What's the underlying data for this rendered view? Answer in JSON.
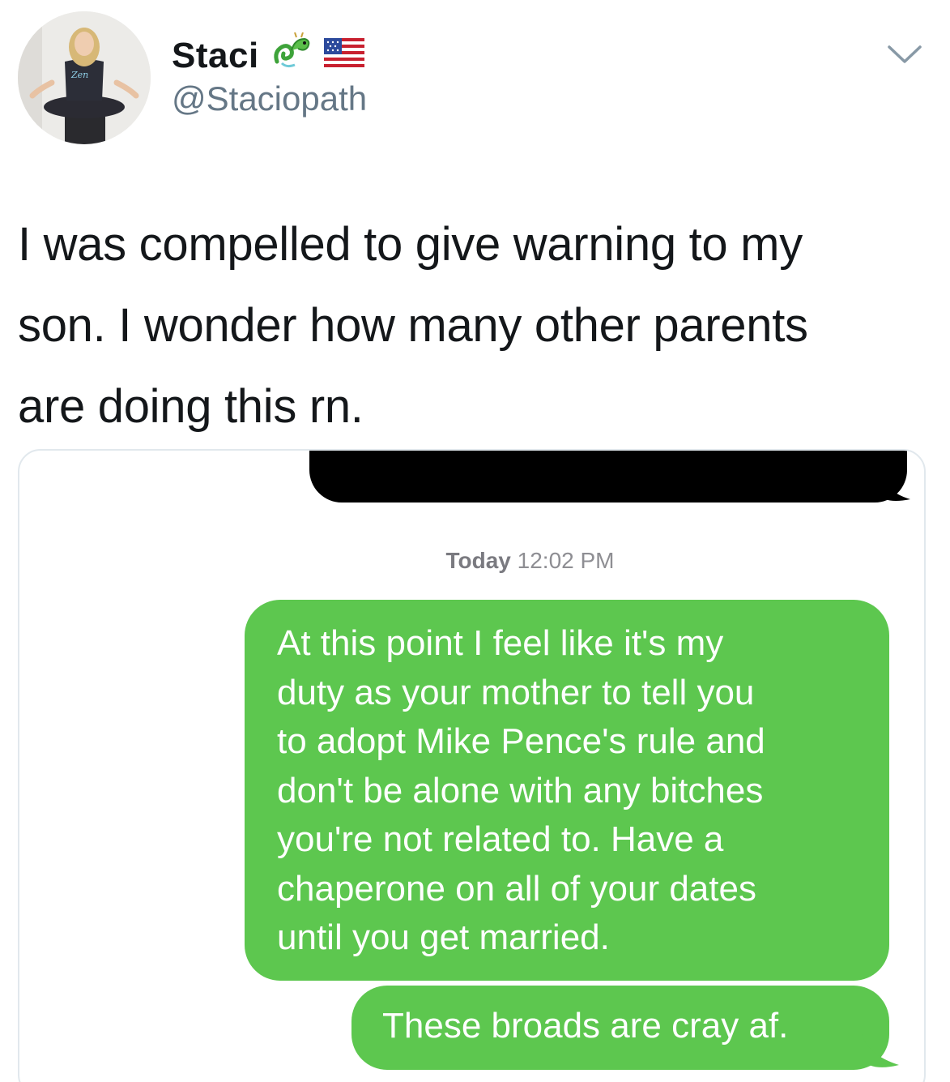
{
  "author": {
    "display_name": "Staci",
    "handle": "@Staciopath",
    "badges": [
      "dragon-emoji",
      "us-flag-emoji"
    ]
  },
  "tweet": {
    "lines": [
      "I was compelled to give warning to my",
      "son. I wonder how many other parents",
      "are doing this rn."
    ]
  },
  "media": {
    "timestamp_day": "Today",
    "timestamp_time": "12:02 PM",
    "messages": [
      {
        "lines": [
          "At this point I feel like it's my",
          "duty as your mother to tell you",
          "to adopt Mike Pence's rule and",
          "don't be alone with any bitches",
          "you're not related to. Have a",
          "chaperone on all of your dates",
          "until you get married."
        ]
      },
      {
        "text": "These broads are cray af."
      }
    ]
  },
  "colors": {
    "bubble_green": "#5dc74f",
    "handle_gray": "#657786",
    "border": "#e1e8ed"
  }
}
